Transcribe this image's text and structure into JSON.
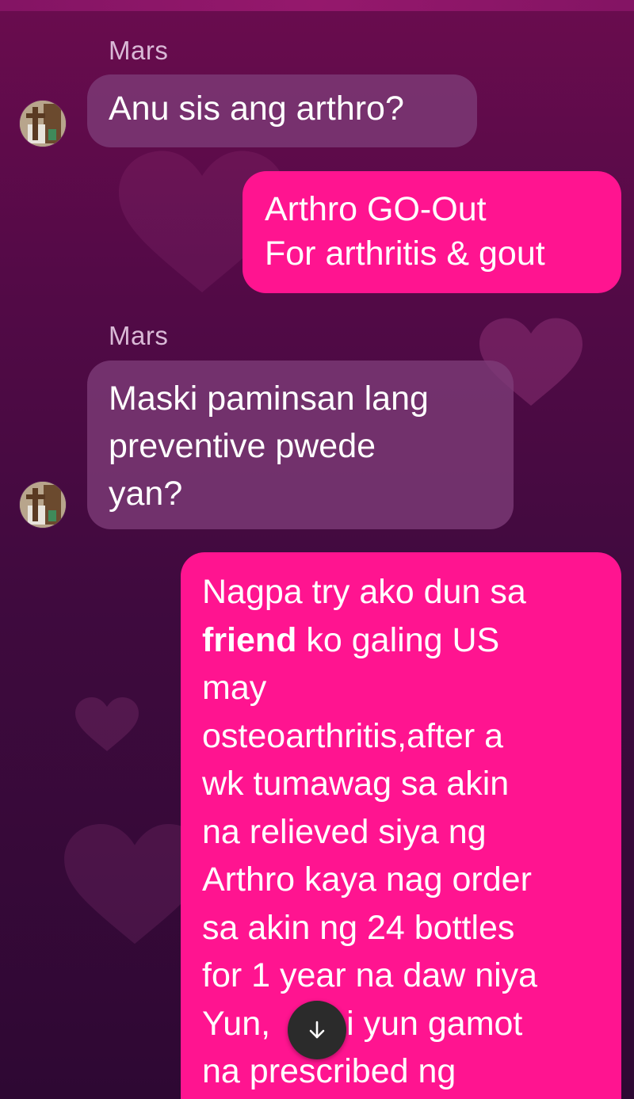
{
  "conversation": {
    "sender_name": "Mars",
    "messages": [
      {
        "direction": "incoming",
        "sender": "Mars",
        "text": "Anu sis ang arthro?"
      },
      {
        "direction": "outgoing",
        "lines": [
          "Arthro GO-Out",
          "For arthritis & gout"
        ]
      },
      {
        "direction": "incoming",
        "sender": "Mars",
        "lines": [
          "Maski paminsan lang",
          "preventive pwede",
          "yan?"
        ]
      },
      {
        "direction": "outgoing",
        "lines": [
          "Nagpa try ako dun sa",
          "ko galing US",
          "may",
          "osteoarthritis,after a",
          "wk tumawag sa akin",
          "na relieved siya ng",
          "Arthro kaya nag order",
          "sa akin ng 24 bottles",
          "for 1 year na daw niya",
          "Yun,",
          "i yun gamot",
          "na prescribed ng"
        ],
        "bold_word": "friend"
      }
    ]
  },
  "scroll_button": {
    "icon": "arrow-down-icon",
    "glyph": "↓"
  },
  "colors": {
    "outgoing_bubble": "#ff1490",
    "incoming_bubble": "#7d3c78",
    "sender_name": "#d9b9d6",
    "background_top": "#6a0c4e",
    "background_bottom": "#2e0833"
  }
}
